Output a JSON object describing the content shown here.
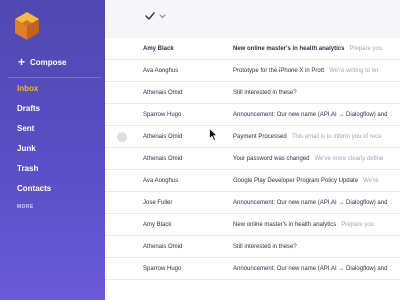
{
  "sidebar": {
    "logo_icon": "cube-logo-icon",
    "compose_icon": "plus-icon",
    "compose_label": "Compose",
    "items": [
      {
        "label": "Inbox",
        "active": true
      },
      {
        "label": "Drafts"
      },
      {
        "label": "Sent"
      },
      {
        "label": "Junk"
      },
      {
        "label": "Trash"
      },
      {
        "label": "Contacts"
      }
    ],
    "more_label": "MORE"
  },
  "toolbar": {
    "select_icon": "checkmark-icon",
    "dropdown_icon": "chevron-down-icon"
  },
  "emails": [
    {
      "sender": "Amy Black",
      "subject": "New online master's in health analytics",
      "preview": "Prepare you",
      "unread": true
    },
    {
      "sender": "Ava Aonghus",
      "subject": "Prototype for the iPhone X in Prott",
      "preview": "We're writing to let"
    },
    {
      "sender": "Athenais Omid",
      "subject": "Still interested in these?",
      "preview": ""
    },
    {
      "sender": "Sparrow Hugo",
      "subject": "Announcement: Our new name (API.AI → Dialogflow) and",
      "preview": ""
    },
    {
      "sender": "Athenais Omid",
      "subject": "Payment Processed",
      "preview": "This email is to inform you of rece",
      "hover": true
    },
    {
      "sender": "Athenais Omid",
      "subject": "Your password was changed",
      "preview": "We've more clearly define"
    },
    {
      "sender": "Ava Aonghus",
      "subject": "Google Play Developer Program Policy Update",
      "preview": "We're"
    },
    {
      "sender": "Jose Fuller",
      "subject": "Announcement: Our new name (API.AI → Dialogflow) and",
      "preview": ""
    },
    {
      "sender": "Amy Black",
      "subject": "New online master's in health analytics",
      "preview": "Prepare you"
    },
    {
      "sender": "Athenais Omid",
      "subject": "Still interested in these?",
      "preview": ""
    },
    {
      "sender": "Sparrow Hugo",
      "subject": "Announcement: Our new name (API.AI → Dialogflow) and",
      "preview": ""
    }
  ],
  "colors": {
    "sidebar": "#5a4fc6",
    "active_nav": "#f6b13a",
    "accent": "#6c63d9"
  }
}
